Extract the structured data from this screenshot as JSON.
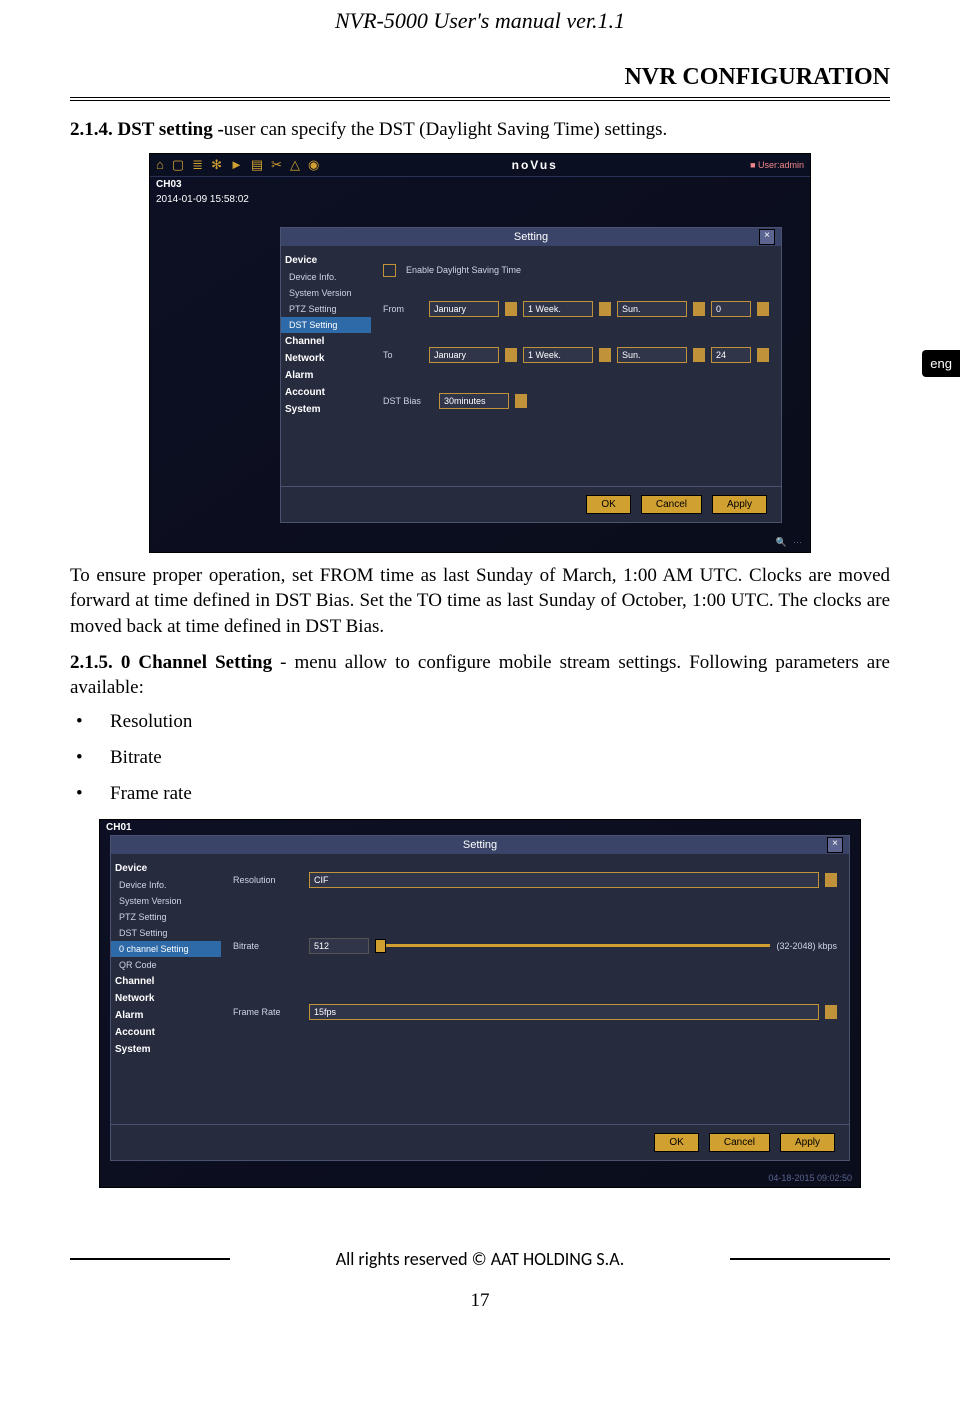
{
  "header": {
    "doc_title": "NVR-5000 User's manual ver.1.1",
    "section_title": "NVR CONFIGURATION"
  },
  "lang_tab": "eng",
  "sec_214": {
    "heading_bold": "2.1.4. DST setting -",
    "heading_rest": "user can specify the DST (Daylight Saving Time) settings."
  },
  "shot1": {
    "brand": "noVus",
    "user": "User:admin",
    "channel": "CH03",
    "timestamp": "2014-01-09 15:58:02",
    "dialog_title": "Setting",
    "side": {
      "cat1": "Device",
      "items1": [
        "Device Info.",
        "System Version",
        "PTZ Setting",
        "DST Setting"
      ],
      "selected": "DST Setting",
      "cats": [
        "Channel",
        "Network",
        "Alarm",
        "Account",
        "System"
      ]
    },
    "panel": {
      "enable_label": "Enable Daylight Saving Time",
      "from": {
        "label": "From",
        "month": "January",
        "week": "1 Week.",
        "day": "Sun.",
        "hour": "0"
      },
      "to": {
        "label": "To",
        "month": "January",
        "week": "1 Week.",
        "day": "Sun.",
        "hour": "24"
      },
      "bias_label": "DST Bias",
      "bias_value": "30minutes"
    },
    "buttons": {
      "ok": "OK",
      "cancel": "Cancel",
      "apply": "Apply"
    }
  },
  "para_after_shot1": "To ensure proper operation, set FROM time as last Sunday of March, 1:00 AM UTC. Clocks are moved forward at time defined in DST Bias. Set the TO time as last Sunday of October, 1:00 UTC. The clocks are moved back at time defined in DST Bias.",
  "sec_215": {
    "heading_bold": "2.1.5. 0 Channel Setting",
    "heading_rest": " - menu allow to configure mobile stream settings. Following parameters are available:",
    "bullets": [
      "Resolution",
      "Bitrate",
      "Frame rate"
    ]
  },
  "shot2": {
    "channel": "CH01",
    "dialog_title": "Setting",
    "side": {
      "cat1": "Device",
      "items1": [
        "Device Info.",
        "System Version",
        "PTZ Setting",
        "DST Setting"
      ],
      "selected": "0 channel Setting",
      "extra": [
        "QR Code"
      ],
      "cats": [
        "Channel",
        "Network",
        "Alarm",
        "Account",
        "System"
      ]
    },
    "panel": {
      "resolution_label": "Resolution",
      "resolution_value": "CIF",
      "bitrate_label": "Bitrate",
      "bitrate_value": "512",
      "bitrate_range": "(32-2048) kbps",
      "frame_label": "Frame Rate",
      "frame_value": "15fps"
    },
    "buttons": {
      "ok": "OK",
      "cancel": "Cancel",
      "apply": "Apply"
    },
    "status_ts": "04-18-2015 09:02:50"
  },
  "footer": {
    "text": "All rights reserved © AAT HOLDING S.A.",
    "page": "17"
  }
}
